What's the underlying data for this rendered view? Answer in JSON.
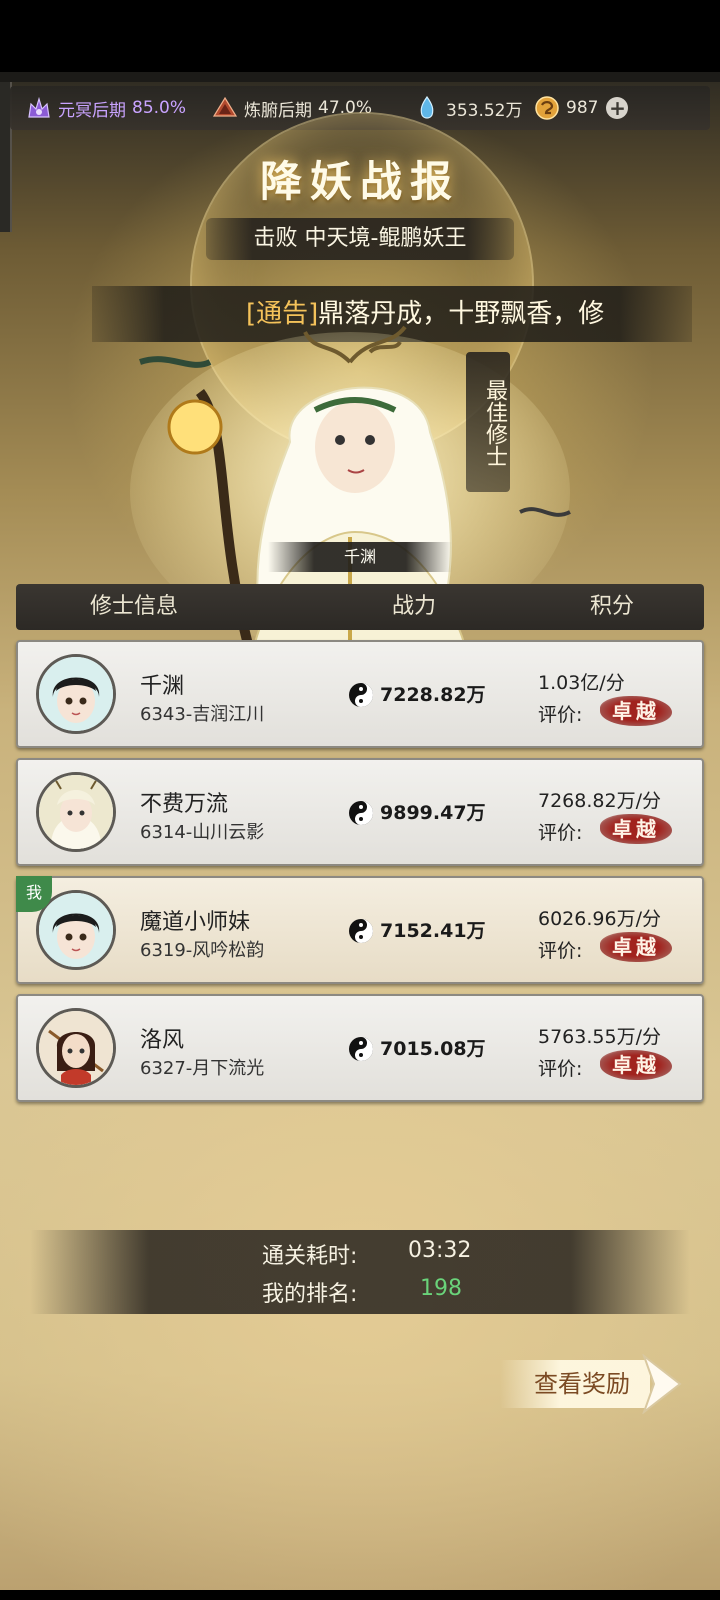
{
  "resources": [
    {
      "icon": "realm-crown-icon",
      "label": "元冥后期",
      "value": "85.0%"
    },
    {
      "icon": "body-refine-icon",
      "label": "炼腑后期",
      "value": "47.0%"
    },
    {
      "icon": "spirit-stone-icon",
      "label": "",
      "value": "353.52万"
    },
    {
      "icon": "jade-coin-icon",
      "label": "",
      "value": "987"
    }
  ],
  "add_button": "+",
  "title": "降妖战报",
  "defeat_text": "击败 中天境-鲲鹏妖王",
  "notice": {
    "tag": "[通告]",
    "text": "鼎落丹成，十野飘香，修"
  },
  "best_label": "最佳修士",
  "hero_name": "千渊",
  "table_headers": {
    "info": "修士信息",
    "power": "战力",
    "score": "积分"
  },
  "eval_label": "评价:",
  "rows": [
    {
      "name": "千渊",
      "server": "6343-吉润江川",
      "power": "7228.82万",
      "score": "1.03亿/分",
      "rating": "卓越",
      "me": false,
      "me_badge": ""
    },
    {
      "name": "不费万流",
      "server": "6314-山川云影",
      "power": "9899.47万",
      "score": "7268.82万/分",
      "rating": "卓越",
      "me": false,
      "me_badge": ""
    },
    {
      "name": "魔道小师妹",
      "server": "6319-风吟松韵",
      "power": "7152.41万",
      "score": "6026.96万/分",
      "rating": "卓越",
      "me": true,
      "me_badge": "我"
    },
    {
      "name": "洛风",
      "server": "6327-月下流光",
      "power": "7015.08万",
      "score": "5763.55万/分",
      "rating": "卓越",
      "me": false,
      "me_badge": ""
    }
  ],
  "summary": {
    "time_label": "通关耗时:",
    "time_value": "03:32",
    "rank_label": "我的排名:",
    "rank_value": "198"
  },
  "reward_button": "查看奖励",
  "colors": {
    "rank_green": "#6ad37a",
    "rating_red": "#a1231e",
    "realm_purple": "#c9a3ff"
  }
}
